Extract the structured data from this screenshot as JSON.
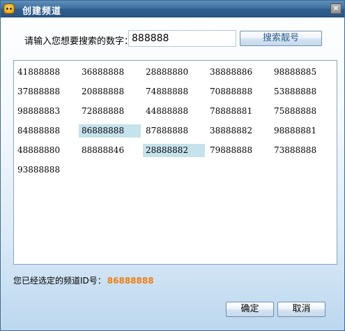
{
  "window": {
    "title": "创建频道",
    "close_label": "×"
  },
  "search": {
    "label": "请输入您想要搜索的数字：",
    "value": "888888",
    "button_label": "搜索靓号"
  },
  "numbers": [
    [
      "41888888",
      "36888888",
      "28888880",
      "38888886",
      "98888885"
    ],
    [
      "37888888",
      "20888888",
      "74888888",
      "70888888",
      "53888888"
    ],
    [
      "98888883",
      "72888888",
      "44888888",
      "78888881",
      "75888888"
    ],
    [
      "84888888",
      "86888888",
      "87888888",
      "38888882",
      "98888881"
    ],
    [
      "48888880",
      "88888846",
      "28888882",
      "79888888",
      "73888888"
    ],
    [
      "93888888"
    ]
  ],
  "highlighted": [
    [
      3,
      1
    ],
    [
      4,
      2
    ]
  ],
  "status": {
    "label": "您已经选定的频道ID号：",
    "value": "86888888"
  },
  "buttons": {
    "ok": "确定",
    "cancel": "取消"
  },
  "colors": {
    "selected_value": "#ef7d0e",
    "highlight": "#c6e2ec",
    "titlebar": "#3d6d9c"
  }
}
